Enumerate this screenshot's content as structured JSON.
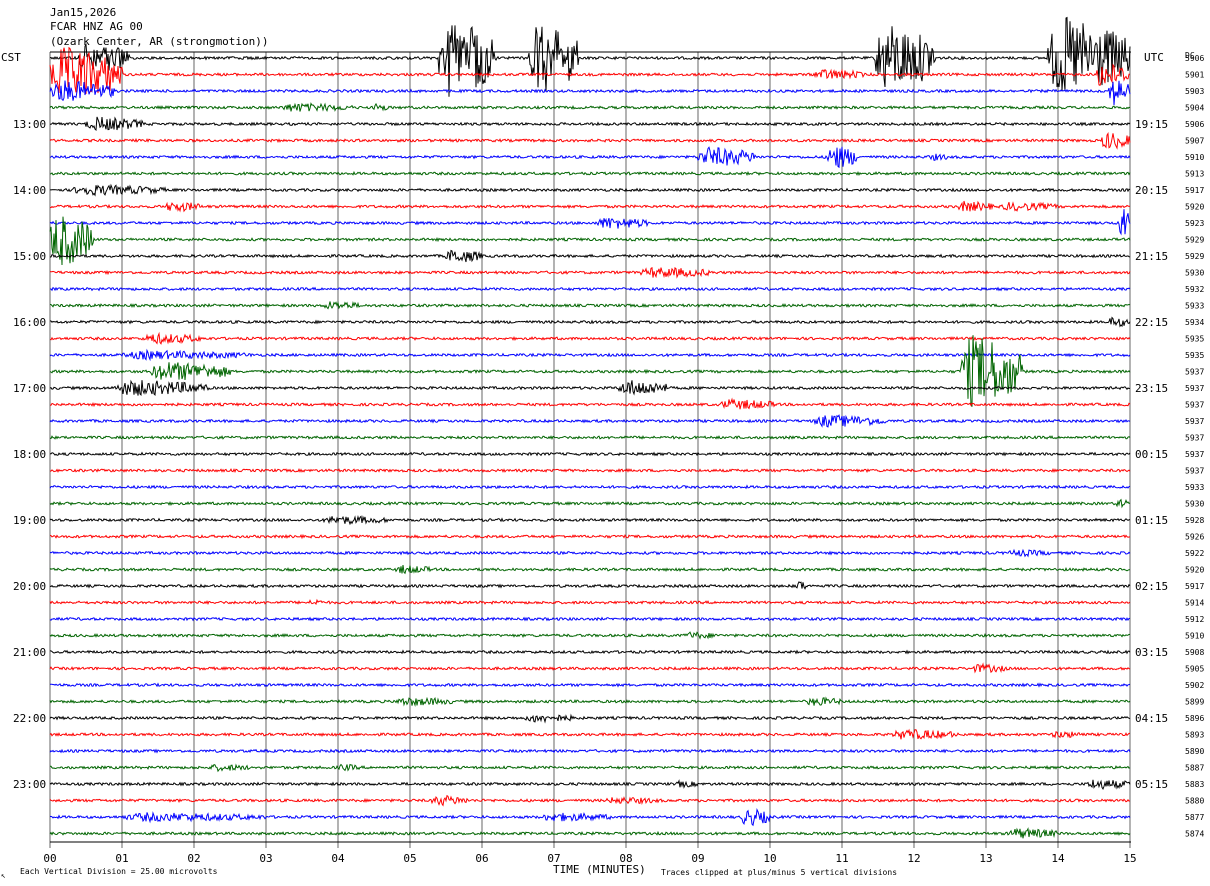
{
  "header": {
    "line1": "Jan15,2026",
    "line2": "FCAR HNZ AG 00",
    "line3": "(Ozark Center, AR (strongmotion))"
  },
  "left_axis_title": "CST",
  "right_axis_title": "UTC",
  "dc_title": "DC",
  "footer": {
    "scale_label": "Each Vertical Division =   25.00 microvolts",
    "xlabel": "TIME (MINUTES)",
    "clip_note": "Traces clipped at plus/minus 5 vertical divisions",
    "corner_mark": "↖"
  },
  "colors": {
    "trace_cycle": [
      "#000000",
      "#ff0000",
      "#0000ff",
      "#006400"
    ],
    "grid": "#000000"
  },
  "chart_data": {
    "type": "line",
    "title": "Jan15,2026",
    "xlabel": "TIME (MINUTES)",
    "ylabel": "",
    "xlim": [
      0,
      15
    ],
    "x_ticks": [
      "00",
      "01",
      "02",
      "03",
      "04",
      "05",
      "06",
      "07",
      "08",
      "09",
      "10",
      "11",
      "12",
      "13",
      "14",
      "15"
    ],
    "left_ticks": [
      {
        "row": 4,
        "label": "13:00"
      },
      {
        "row": 8,
        "label": "14:00"
      },
      {
        "row": 12,
        "label": "15:00"
      },
      {
        "row": 16,
        "label": "16:00"
      },
      {
        "row": 20,
        "label": "17:00"
      },
      {
        "row": 24,
        "label": "18:00"
      },
      {
        "row": 28,
        "label": "19:00"
      },
      {
        "row": 32,
        "label": "20:00"
      },
      {
        "row": 36,
        "label": "21:00"
      },
      {
        "row": 40,
        "label": "22:00"
      },
      {
        "row": 44,
        "label": "23:00"
      }
    ],
    "right_ticks": [
      {
        "row": 4,
        "label": "19:15"
      },
      {
        "row": 8,
        "label": "20:15"
      },
      {
        "row": 12,
        "label": "21:15"
      },
      {
        "row": 16,
        "label": "22:15"
      },
      {
        "row": 20,
        "label": "23:15"
      },
      {
        "row": 24,
        "label": "00:15"
      },
      {
        "row": 28,
        "label": "01:15"
      },
      {
        "row": 32,
        "label": "02:15"
      },
      {
        "row": 36,
        "label": "03:15"
      },
      {
        "row": 40,
        "label": "04:15"
      },
      {
        "row": 44,
        "label": "05:15"
      }
    ],
    "dc_values": [
      "5906",
      "5901",
      "5903",
      "5904",
      "5906",
      "5907",
      "5910",
      "5913",
      "5917",
      "5920",
      "5923",
      "5929",
      "5929",
      "5930",
      "5932",
      "5933",
      "5934",
      "5935",
      "5935",
      "5937",
      "5937",
      "5937",
      "5937",
      "5937",
      "5937",
      "5937",
      "5933",
      "5930",
      "5928",
      "5926",
      "5922",
      "5920",
      "5917",
      "5914",
      "5912",
      "5910",
      "5908",
      "5905",
      "5902",
      "5899",
      "5896",
      "5893",
      "5890",
      "5887",
      "5883",
      "5880",
      "5877",
      "5874"
    ],
    "trace_count": 48,
    "noise_amplitude": 1.3,
    "events": [
      {
        "row": 0,
        "start": 5.4,
        "end": 6.2,
        "amp": 42,
        "clip": true
      },
      {
        "row": 0,
        "start": 6.65,
        "end": 7.35,
        "amp": 40,
        "clip": true
      },
      {
        "row": 0,
        "start": 11.45,
        "end": 12.3,
        "amp": 38,
        "clip": true
      },
      {
        "row": 0,
        "start": 13.85,
        "end": 15.0,
        "amp": 45,
        "clip": true
      },
      {
        "row": 0,
        "start": 0.4,
        "end": 1.1,
        "amp": 18,
        "clip": false
      },
      {
        "row": 1,
        "start": 0.0,
        "end": 1.0,
        "amp": 30,
        "clip": true
      },
      {
        "row": 1,
        "start": 10.6,
        "end": 11.3,
        "amp": 6,
        "clip": false
      },
      {
        "row": 1,
        "start": 14.5,
        "end": 15.0,
        "amp": 14,
        "clip": true
      },
      {
        "row": 2,
        "start": 0.0,
        "end": 0.9,
        "amp": 12,
        "clip": false
      },
      {
        "row": 2,
        "start": 14.7,
        "end": 15.0,
        "amp": 16,
        "clip": true
      },
      {
        "row": 3,
        "start": 3.2,
        "end": 4.2,
        "amp": 5,
        "clip": false
      },
      {
        "row": 3,
        "start": 4.5,
        "end": 4.7,
        "amp": 5,
        "clip": false
      },
      {
        "row": 4,
        "start": 0.5,
        "end": 1.3,
        "amp": 8,
        "clip": false
      },
      {
        "row": 5,
        "start": 14.6,
        "end": 15.0,
        "amp": 10,
        "clip": false
      },
      {
        "row": 6,
        "start": 9.0,
        "end": 9.8,
        "amp": 11,
        "clip": false
      },
      {
        "row": 6,
        "start": 10.8,
        "end": 11.2,
        "amp": 14,
        "clip": false
      },
      {
        "row": 6,
        "start": 12.2,
        "end": 12.5,
        "amp": 4,
        "clip": false
      },
      {
        "row": 8,
        "start": 0.3,
        "end": 1.6,
        "amp": 6,
        "clip": false
      },
      {
        "row": 9,
        "start": 1.6,
        "end": 2.1,
        "amp": 6,
        "clip": false
      },
      {
        "row": 9,
        "start": 12.6,
        "end": 13.1,
        "amp": 6,
        "clip": false
      },
      {
        "row": 9,
        "start": 13.2,
        "end": 14.0,
        "amp": 5,
        "clip": false
      },
      {
        "row": 10,
        "start": 7.6,
        "end": 8.3,
        "amp": 7,
        "clip": false
      },
      {
        "row": 10,
        "start": 14.85,
        "end": 15.0,
        "amp": 20,
        "clip": true
      },
      {
        "row": 11,
        "start": 0.0,
        "end": 0.6,
        "amp": 30,
        "clip": true
      },
      {
        "row": 12,
        "start": 5.5,
        "end": 6.0,
        "amp": 8,
        "clip": false
      },
      {
        "row": 13,
        "start": 8.2,
        "end": 9.2,
        "amp": 6,
        "clip": false
      },
      {
        "row": 15,
        "start": 3.8,
        "end": 4.3,
        "amp": 5,
        "clip": false
      },
      {
        "row": 16,
        "start": 14.7,
        "end": 15.0,
        "amp": 6,
        "clip": false
      },
      {
        "row": 17,
        "start": 1.3,
        "end": 2.1,
        "amp": 6,
        "clip": false
      },
      {
        "row": 18,
        "start": 1.0,
        "end": 2.8,
        "amp": 5,
        "clip": false
      },
      {
        "row": 19,
        "start": 1.4,
        "end": 2.5,
        "amp": 11,
        "clip": false
      },
      {
        "row": 19,
        "start": 12.65,
        "end": 13.5,
        "amp": 40,
        "clip": true
      },
      {
        "row": 20,
        "start": 0.9,
        "end": 2.2,
        "amp": 9,
        "clip": false
      },
      {
        "row": 20,
        "start": 7.9,
        "end": 8.6,
        "amp": 9,
        "clip": false
      },
      {
        "row": 21,
        "start": 9.3,
        "end": 10.1,
        "amp": 6,
        "clip": false
      },
      {
        "row": 22,
        "start": 10.6,
        "end": 11.6,
        "amp": 7,
        "clip": false
      },
      {
        "row": 27,
        "start": 14.8,
        "end": 15.0,
        "amp": 5,
        "clip": false
      },
      {
        "row": 28,
        "start": 3.8,
        "end": 4.7,
        "amp": 5,
        "clip": false
      },
      {
        "row": 30,
        "start": 13.3,
        "end": 13.9,
        "amp": 4,
        "clip": false
      },
      {
        "row": 31,
        "start": 4.8,
        "end": 5.3,
        "amp": 5,
        "clip": false
      },
      {
        "row": 32,
        "start": 10.35,
        "end": 10.5,
        "amp": 7,
        "clip": false
      },
      {
        "row": 33,
        "start": 3.6,
        "end": 3.8,
        "amp": 4,
        "clip": false
      },
      {
        "row": 35,
        "start": 8.8,
        "end": 9.3,
        "amp": 4,
        "clip": false
      },
      {
        "row": 37,
        "start": 12.8,
        "end": 13.3,
        "amp": 5,
        "clip": false
      },
      {
        "row": 39,
        "start": 4.8,
        "end": 5.6,
        "amp": 5,
        "clip": false
      },
      {
        "row": 39,
        "start": 10.5,
        "end": 11.0,
        "amp": 5,
        "clip": false
      },
      {
        "row": 40,
        "start": 6.6,
        "end": 7.3,
        "amp": 5,
        "clip": false
      },
      {
        "row": 41,
        "start": 11.7,
        "end": 12.6,
        "amp": 6,
        "clip": false
      },
      {
        "row": 41,
        "start": 13.9,
        "end": 14.4,
        "amp": 4,
        "clip": false
      },
      {
        "row": 43,
        "start": 2.2,
        "end": 2.8,
        "amp": 4,
        "clip": false
      },
      {
        "row": 43,
        "start": 4.0,
        "end": 4.3,
        "amp": 4,
        "clip": false
      },
      {
        "row": 44,
        "start": 14.4,
        "end": 15.0,
        "amp": 6,
        "clip": false
      },
      {
        "row": 44,
        "start": 8.7,
        "end": 9.0,
        "amp": 4,
        "clip": false
      },
      {
        "row": 45,
        "start": 5.3,
        "end": 5.8,
        "amp": 6,
        "clip": false
      },
      {
        "row": 45,
        "start": 7.7,
        "end": 8.5,
        "amp": 4,
        "clip": false
      },
      {
        "row": 46,
        "start": 1.0,
        "end": 3.0,
        "amp": 5,
        "clip": false
      },
      {
        "row": 46,
        "start": 9.6,
        "end": 10.0,
        "amp": 10,
        "clip": false
      },
      {
        "row": 46,
        "start": 6.8,
        "end": 7.8,
        "amp": 5,
        "clip": false
      },
      {
        "row": 47,
        "start": 13.3,
        "end": 14.0,
        "amp": 6,
        "clip": false
      }
    ]
  }
}
